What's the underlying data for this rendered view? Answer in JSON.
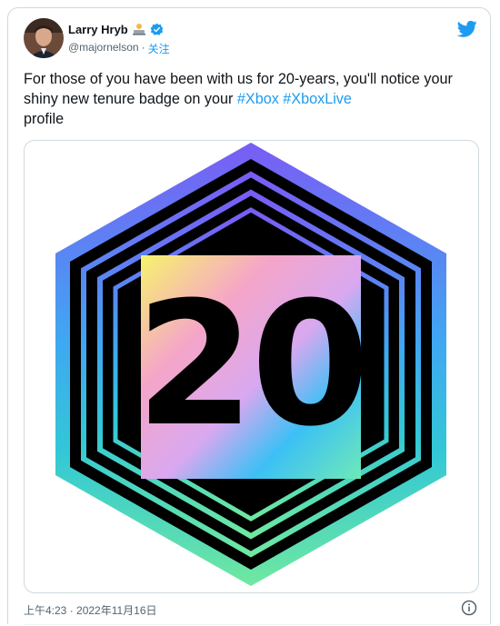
{
  "author": {
    "display_name": "Larry Hryb",
    "handle": "@majornelson",
    "separator": "·",
    "follow_label": "关注",
    "badge_emoji_icon": "laptop-user-icon",
    "verified_icon": "verified-badge-icon",
    "avatar_icon": "avatar"
  },
  "tweet": {
    "text_part1": "For those of you have been with us for 20-years, you'll notice your shiny new tenure badge on your ",
    "hashtag1": "#Xbox",
    "space": " ",
    "hashtag2": "#XboxLive",
    "text_part2": " profile",
    "media": {
      "badge_number": "20"
    },
    "timestamp": "上午4:23 · 2022年11月16日"
  },
  "icons": {
    "twitter": "twitter-bird-icon",
    "info": "info-icon"
  },
  "colors": {
    "accent": "#1d9bf0",
    "text": "#0f1419",
    "muted": "#536471",
    "gradient_top": "#7a5cf5",
    "gradient_bottom": "#6fe8a0"
  }
}
